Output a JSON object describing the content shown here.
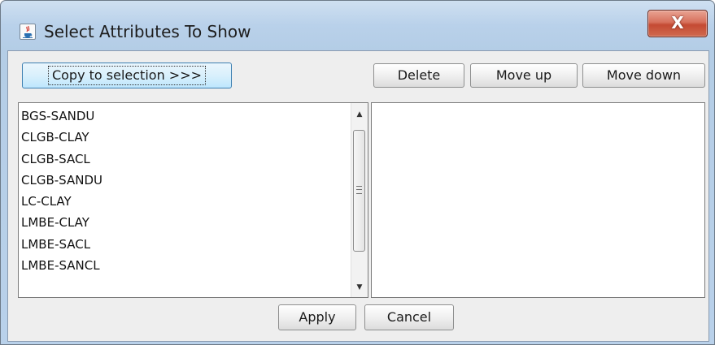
{
  "window": {
    "title": "Select Attributes To Show",
    "close_label": "X"
  },
  "toolbar": {
    "copy_label": "Copy to selection >>>",
    "delete_label": "Delete",
    "move_up_label": "Move up",
    "move_down_label": "Move down"
  },
  "available_list": {
    "items": [
      {
        "label": "BGS-SANDU"
      },
      {
        "label": "CLGB-CLAY"
      },
      {
        "label": "CLGB-SACL"
      },
      {
        "label": "CLGB-SANDU"
      },
      {
        "label": "LC-CLAY"
      },
      {
        "label": "LMBE-CLAY"
      },
      {
        "label": "LMBE-SACL"
      },
      {
        "label": "LMBE-SANCL"
      }
    ]
  },
  "selected_list": {
    "items": []
  },
  "footer": {
    "apply_label": "Apply",
    "cancel_label": "Cancel"
  },
  "icons": {
    "app": "java-cup-icon",
    "close": "close-icon",
    "scroll_up": "scroll-up-arrow-icon",
    "scroll_down": "scroll-down-arrow-icon"
  },
  "colors": {
    "title_bar": "#b9d1ea",
    "close_button": "#c44a33",
    "content_bg": "#eeeeee",
    "focus_button": "#d9f0fc"
  }
}
